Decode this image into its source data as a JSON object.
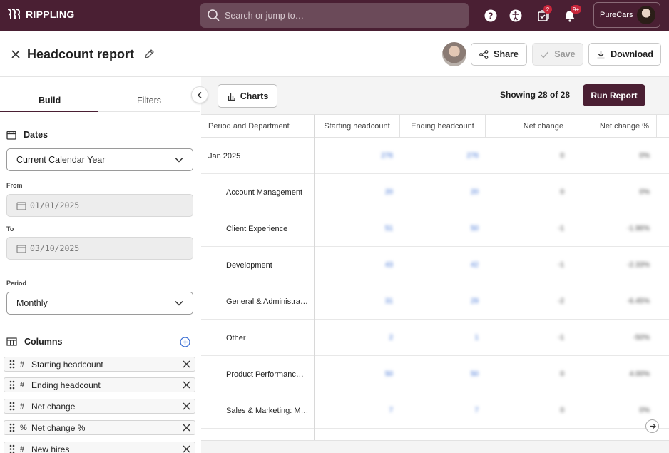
{
  "app": {
    "brand": "RIPPLING",
    "company": "PureCars"
  },
  "search": {
    "placeholder": "Search or jump to…"
  },
  "notifications": {
    "tasks_badge": "2",
    "bell_badge": "9+"
  },
  "header": {
    "title": "Headcount report",
    "share_label": "Share",
    "save_label": "Save",
    "download_label": "Download"
  },
  "left": {
    "tabs": [
      "Build",
      "Filters"
    ],
    "dates_heading": "Dates",
    "date_range": "Current Calendar Year",
    "from_label": "From",
    "from_value": "01/01/2025",
    "to_label": "To",
    "to_value": "03/10/2025",
    "period_label": "Period",
    "period_value": "Monthly",
    "columns_heading": "Columns",
    "columns": [
      {
        "icon": "#",
        "name": "Starting headcount"
      },
      {
        "icon": "#",
        "name": "Ending headcount"
      },
      {
        "icon": "#",
        "name": "Net change"
      },
      {
        "icon": "%",
        "name": "Net change %"
      },
      {
        "icon": "#",
        "name": "New hires"
      }
    ]
  },
  "main": {
    "charts_label": "Charts",
    "showing": "Showing 28 of 28",
    "run_label": "Run Report",
    "headers": [
      "Period and Department",
      "Starting headcount",
      "Ending headcount",
      "Net change",
      "Net change %"
    ],
    "rows": [
      {
        "name": "Jan 2025",
        "indent": false,
        "start": "276",
        "end": "276",
        "net": "0",
        "pct": "0%"
      },
      {
        "name": "Account Management",
        "indent": true,
        "start": "20",
        "end": "20",
        "net": "0",
        "pct": "0%"
      },
      {
        "name": "Client Experience",
        "indent": true,
        "start": "51",
        "end": "50",
        "net": "-1",
        "pct": "-1.96%"
      },
      {
        "name": "Development",
        "indent": true,
        "start": "43",
        "end": "42",
        "net": "-1",
        "pct": "-2.33%"
      },
      {
        "name": "General & Administra…",
        "indent": true,
        "start": "31",
        "end": "29",
        "net": "-2",
        "pct": "-6.45%"
      },
      {
        "name": "Other",
        "indent": true,
        "start": "2",
        "end": "1",
        "net": "-1",
        "pct": "-50%"
      },
      {
        "name": "Product Performanc…",
        "indent": true,
        "start": "50",
        "end": "50",
        "net": "0",
        "pct": "4.00%"
      },
      {
        "name": "Sales & Marketing: M…",
        "indent": true,
        "start": "7",
        "end": "7",
        "net": "0",
        "pct": "0%"
      }
    ]
  }
}
